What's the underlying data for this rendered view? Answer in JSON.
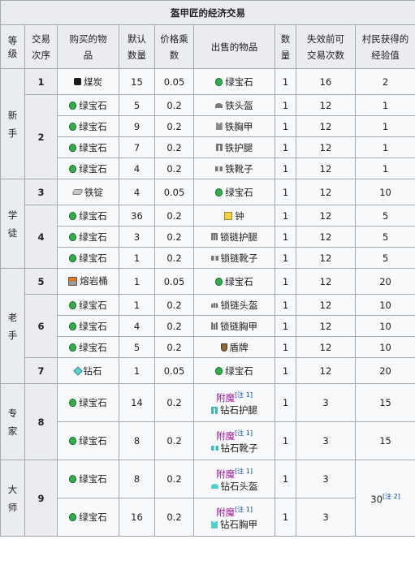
{
  "caption": "盔甲匠的经济交易",
  "headers": {
    "level": "等\n级",
    "trade_order": "交易\n次序",
    "buy_item": "购买的物\n品",
    "default_qty": "默认\n数量",
    "price_mult": "价格乘\n数",
    "sell_item": "出售的物品",
    "qty": "数\n量",
    "max_trades": "失效前可\n交易次数",
    "villager_xp": "村民获得的\n经验值"
  },
  "levels": {
    "novice": "新\n手",
    "apprentice": "学\n徒",
    "journeyman": "老\n手",
    "expert": "专\n家",
    "master": "大\n师"
  },
  "trades": {
    "1": "1",
    "2": "2",
    "3": "3",
    "4": "4",
    "5": "5",
    "6": "6",
    "7": "7",
    "8": "8",
    "9": "9"
  },
  "items": {
    "coal": "煤炭",
    "emerald": "绿宝石",
    "iron_helmet": "铁头盔",
    "iron_chestplate": "铁胸甲",
    "iron_leggings": "铁护腿",
    "iron_boots": "铁靴子",
    "iron_ingot": "铁锭",
    "bell": "钟",
    "chain_leggings": "锁链护腿",
    "chain_boots": "锁链靴子",
    "lava_bucket": "熔岩桶",
    "chain_helmet": "锁链头盔",
    "chain_chestplate": "锁链胸甲",
    "shield": "盾牌",
    "diamond": "钻石",
    "enchanted": "附魔",
    "note1": "[注 1]",
    "note2": "[注 2]",
    "diamond_leggings": "钻石护腿",
    "diamond_boots": "钻石靴子",
    "diamond_helmet": "钻石头盔",
    "diamond_chestplate": "钻石胸甲"
  },
  "values": {
    "r1": {
      "qty": "15",
      "mult": "0.05",
      "sold": "1",
      "max": "16",
      "xp": "2"
    },
    "r2": {
      "qty": "5",
      "mult": "0.2",
      "sold": "1",
      "max": "12",
      "xp": "1"
    },
    "r3": {
      "qty": "9",
      "mult": "0.2",
      "sold": "1",
      "max": "12",
      "xp": "1"
    },
    "r4": {
      "qty": "7",
      "mult": "0.2",
      "sold": "1",
      "max": "12",
      "xp": "1"
    },
    "r5": {
      "qty": "4",
      "mult": "0.2",
      "sold": "1",
      "max": "12",
      "xp": "1"
    },
    "r6": {
      "qty": "4",
      "mult": "0.05",
      "sold": "1",
      "max": "12",
      "xp": "10"
    },
    "r7": {
      "qty": "36",
      "mult": "0.2",
      "sold": "1",
      "max": "12",
      "xp": "5"
    },
    "r8": {
      "qty": "3",
      "mult": "0.2",
      "sold": "1",
      "max": "12",
      "xp": "5"
    },
    "r9": {
      "qty": "1",
      "mult": "0.2",
      "sold": "1",
      "max": "12",
      "xp": "5"
    },
    "r10": {
      "qty": "1",
      "mult": "0.05",
      "sold": "1",
      "max": "12",
      "xp": "20"
    },
    "r11": {
      "qty": "1",
      "mult": "0.2",
      "sold": "1",
      "max": "12",
      "xp": "10"
    },
    "r12": {
      "qty": "4",
      "mult": "0.2",
      "sold": "1",
      "max": "12",
      "xp": "10"
    },
    "r13": {
      "qty": "5",
      "mult": "0.2",
      "sold": "1",
      "max": "12",
      "xp": "10"
    },
    "r14": {
      "qty": "1",
      "mult": "0.05",
      "sold": "1",
      "max": "12",
      "xp": "20"
    },
    "r15": {
      "qty": "14",
      "mult": "0.2",
      "sold": "1",
      "max": "3",
      "xp": "15"
    },
    "r16": {
      "qty": "8",
      "mult": "0.2",
      "sold": "1",
      "max": "3",
      "xp": "15"
    },
    "r17": {
      "qty": "8",
      "mult": "0.2",
      "sold": "1",
      "max": "3",
      "xp": "30"
    },
    "r18": {
      "qty": "16",
      "mult": "0.2",
      "sold": "1",
      "max": "3",
      "xp": ""
    }
  }
}
